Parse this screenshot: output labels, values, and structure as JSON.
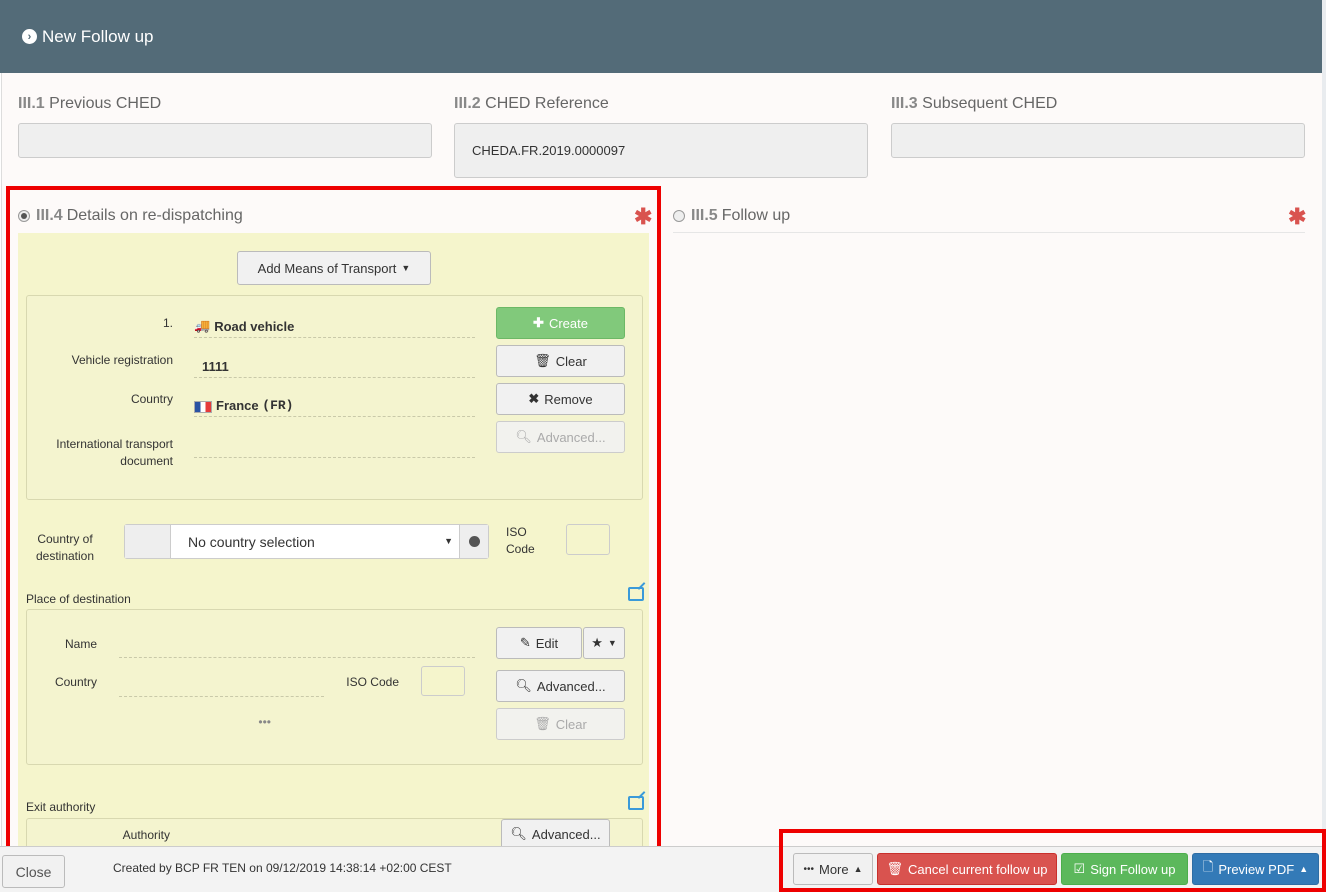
{
  "header": {
    "icon": "chevron-circle-right-icon",
    "title": "New Follow up"
  },
  "top_fields": {
    "previous": {
      "num": "III.1",
      "label": "Previous CHED",
      "value": ""
    },
    "reference": {
      "num": "III.2",
      "label": "CHED Reference",
      "value": "CHEDA.FR.2019.0000097"
    },
    "subsequent": {
      "num": "III.3",
      "label": "Subsequent CHED",
      "value": ""
    }
  },
  "redispatch": {
    "num": "III.4",
    "label": "Details on re-dispatching",
    "required": "✱",
    "add_transport_label": "Add Means of Transport",
    "transport": {
      "index_label": "1.",
      "type": "Road vehicle",
      "vehicle_registration_label": "Vehicle registration",
      "vehicle_registration": "1111",
      "country_label": "Country",
      "country_name": "France",
      "country_code": "(FR)",
      "itd_label": "International transport document",
      "itd_value": "",
      "create_label": "Create",
      "clear_label": "Clear",
      "remove_label": "Remove",
      "advanced_label": "Advanced..."
    },
    "destination_country": {
      "label": "Country of destination",
      "select_value": "No country selection",
      "iso_label": "ISO Code",
      "iso_value": ""
    },
    "place_of_destination": {
      "label": "Place of destination",
      "name_label": "Name",
      "name_value": "",
      "country_label": "Country",
      "country_value": "",
      "iso_label": "ISO Code",
      "iso_value": "",
      "more": "•••",
      "edit_label": "Edit",
      "advanced_label": "Advanced...",
      "clear_label": "Clear"
    },
    "exit_authority": {
      "label": "Exit authority",
      "authority_label": "Authority",
      "advanced_label": "Advanced..."
    }
  },
  "follow_up": {
    "num": "III.5",
    "label": "Follow up",
    "required": "✱"
  },
  "footer": {
    "close_label": "Close",
    "created": "Created by BCP FR TEN on 09/12/2019 14:38:14 +02:00 CEST",
    "more_label": "More",
    "cancel_label": "Cancel current follow up",
    "sign_label": "Sign Follow up",
    "preview_label": "Preview PDF"
  },
  "colors": {
    "header_bg": "#536b78",
    "highlight": "#ee0000",
    "panel_bg": "#f5f5cc"
  }
}
